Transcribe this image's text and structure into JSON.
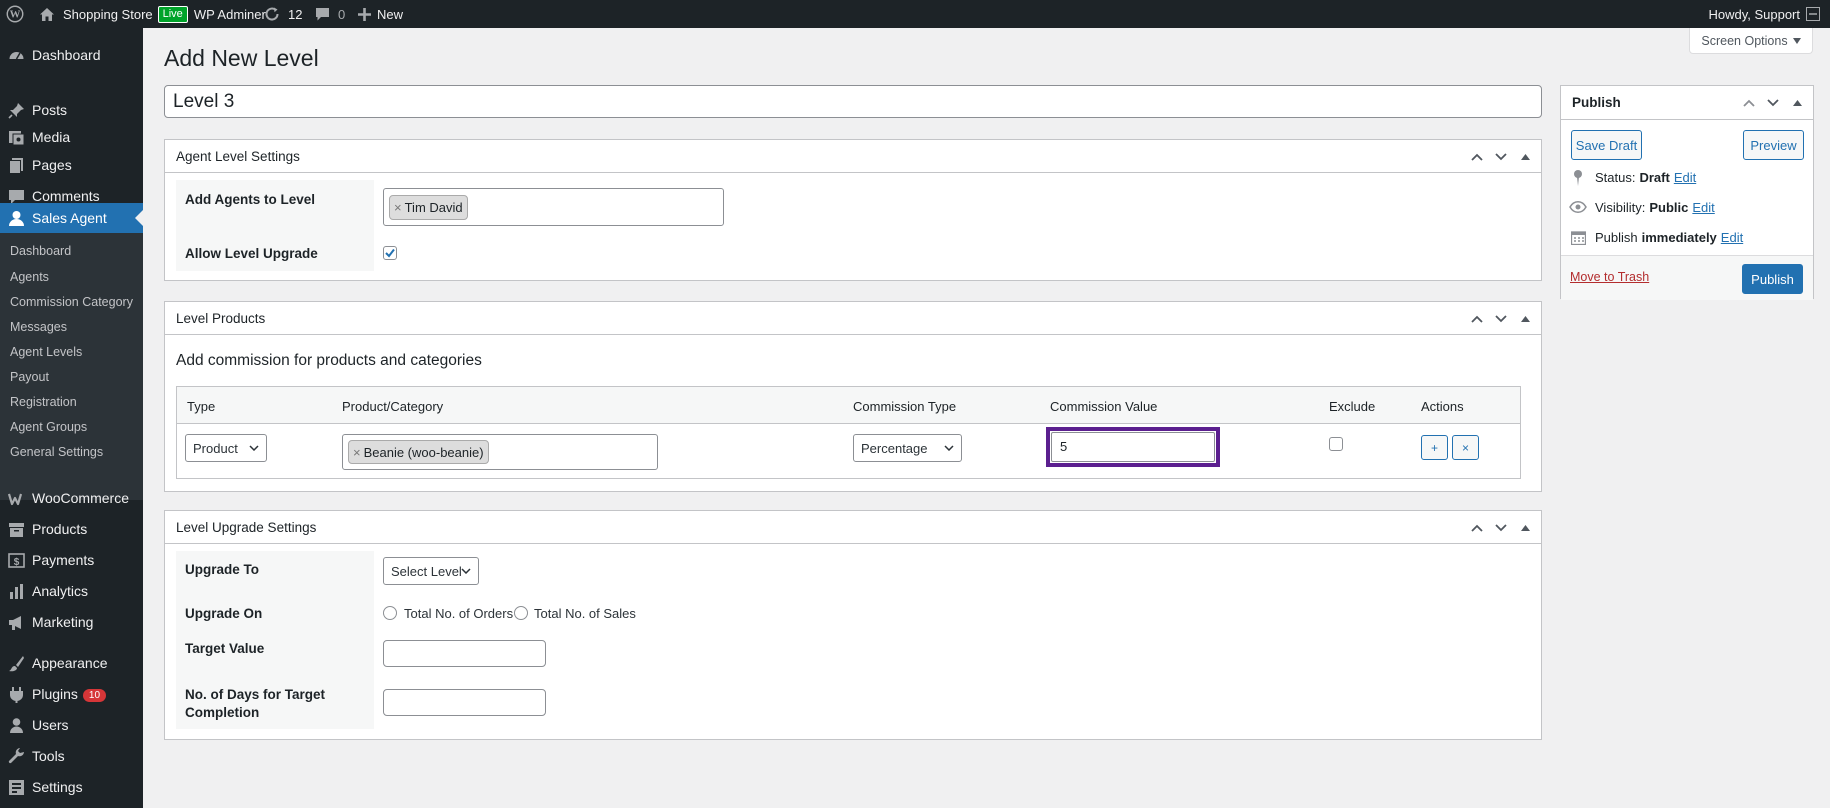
{
  "adminbar": {
    "site_name": "Shopping Store",
    "live_label": "Live",
    "wp_admin_label": "WP Adminer",
    "updates_count": "12",
    "comments_count": "0",
    "new_label": "New",
    "howdy": "Howdy, Support"
  },
  "sidebar": {
    "top_items": [
      "Dashboard",
      "Posts",
      "Media",
      "Pages",
      "Comments"
    ],
    "current_item": "Sales Agent",
    "submenu": [
      "Dashboard",
      "Agents",
      "Commission Category",
      "Messages",
      "Agent Levels",
      "Payout",
      "Registration",
      "Agent Groups",
      "General Settings"
    ],
    "bottom_items": [
      "WooCommerce",
      "Products",
      "Payments",
      "Analytics",
      "Marketing",
      "Appearance",
      "Plugins",
      "Users",
      "Tools",
      "Settings"
    ],
    "plugins_badge": "10"
  },
  "page": {
    "title": "Add New Level",
    "screen_options": "Screen Options",
    "level_title_value": "Level 3"
  },
  "agent_level_settings": {
    "header": "Agent Level Settings",
    "add_agents_label": "Add Agents to Level",
    "agent_chip": "Tim David",
    "allow_upgrade_label": "Allow Level Upgrade",
    "allow_upgrade_checked": true
  },
  "level_products": {
    "header": "Level Products",
    "heading": "Add commission for products and categories",
    "columns": [
      "Type",
      "Product/Category",
      "Commission Type",
      "Commission Value",
      "Exclude",
      "Actions"
    ],
    "row": {
      "type": "Product",
      "product_chip": "Beanie (woo-beanie)",
      "commission_type": "Percentage",
      "commission_value": "5",
      "exclude_checked": false,
      "add_label": "+",
      "remove_label": "×"
    }
  },
  "level_upgrade_settings": {
    "header": "Level Upgrade Settings",
    "upgrade_to_label": "Upgrade To",
    "upgrade_to_value": "Select Level",
    "upgrade_on_label": "Upgrade On",
    "upgrade_on_options": [
      "Total No. of Orders",
      "Total No. of Sales"
    ],
    "target_value_label": "Target Value",
    "target_value": "",
    "days_label_line1": "No. of Days for Target",
    "days_label_line2": "Completion",
    "days_value": ""
  },
  "publish": {
    "header": "Publish",
    "save_draft": "Save Draft",
    "preview": "Preview",
    "status_label": "Status:",
    "status_value": "Draft",
    "visibility_label": "Visibility:",
    "visibility_value": "Public",
    "publish_label": "Publish",
    "publish_value": "immediately",
    "edit_label": "Edit",
    "move_to_trash": "Move to Trash",
    "publish_button": "Publish"
  },
  "colors": {
    "adminbar_bg": "#1d2327",
    "accent": "#2271b1",
    "focus_outline": "#5b1f8f",
    "badge_red": "#d63638",
    "live_green": "#00a32a"
  }
}
